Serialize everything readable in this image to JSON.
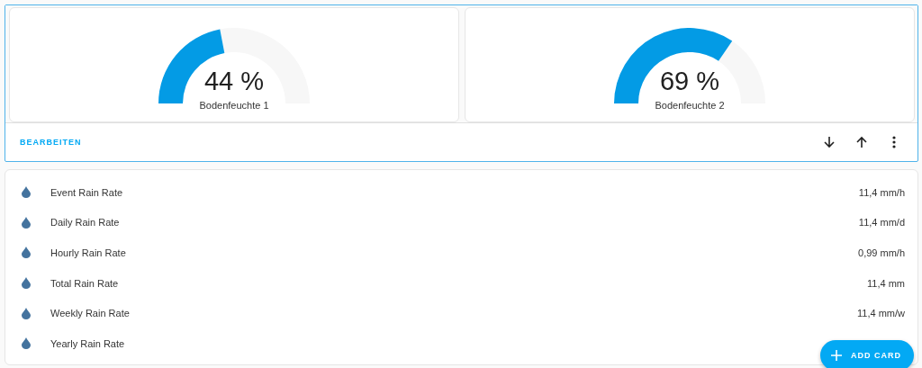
{
  "gauges": [
    {
      "value": "44 %",
      "label": "Bodenfeuchte 1"
    },
    {
      "value": "69 %",
      "label": "Bodenfeuchte 2"
    }
  ],
  "edit_bar": {
    "edit_label": "BEARBEITEN"
  },
  "entities": [
    {
      "name": "Event Rain Rate",
      "value": "11,4 mm/h"
    },
    {
      "name": "Daily Rain Rate",
      "value": "11,4 mm/d"
    },
    {
      "name": "Hourly Rain Rate",
      "value": "0,99 mm/h"
    },
    {
      "name": "Total Rain Rate",
      "value": "11,4 mm"
    },
    {
      "name": "Weekly Rain Rate",
      "value": "11,4 mm/w"
    },
    {
      "name": "Yearly Rain Rate"
    }
  ],
  "fab": {
    "label": "ADD CARD"
  }
}
